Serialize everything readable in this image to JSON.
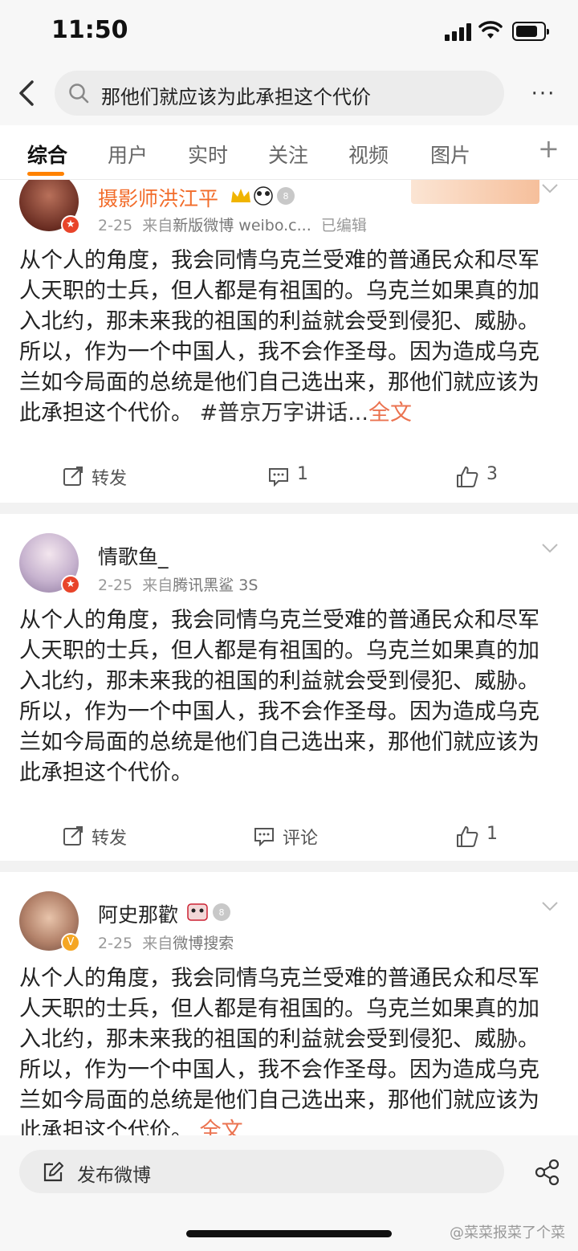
{
  "status": {
    "time": "11:50"
  },
  "search": {
    "query": "那他们就应该为此承担这个代价",
    "more": "···"
  },
  "tabs": [
    {
      "label": "综合"
    },
    {
      "label": "用户"
    },
    {
      "label": "实时"
    },
    {
      "label": "关注"
    },
    {
      "label": "视频"
    },
    {
      "label": "图片"
    }
  ],
  "tab_add": "+",
  "posts": [
    {
      "name": "摄影师洪江平",
      "date": "2-25",
      "source_prefix": "来自",
      "source": "新版微博 weibo.c...",
      "edited": "已编辑",
      "text": "从个人的角度，我会同情乌克兰受难的普通民众和尽军人天职的士兵，但人都是有祖国的。乌克兰如果真的加入北约，那未来我的祖国的利益就会受到侵犯、威胁。所以，作为一个中国人，我不会作圣母。因为造成乌克兰如今局面的总统是他们自己选出来，那他们就应该为此承担这个代价。",
      "hashtag": "#普京万字讲话...",
      "more": "全文",
      "repost": "转发",
      "comment": "1",
      "like": "3"
    },
    {
      "name": "情歌鱼_",
      "date": "2-25",
      "source_prefix": "来自",
      "source": "腾讯黑鲨 3S",
      "text": "从个人的角度，我会同情乌克兰受难的普通民众和尽军人天职的士兵，但人都是有祖国的。乌克兰如果真的加入北约，那未来我的祖国的利益就会受到侵犯、威胁。所以，作为一个中国人，我不会作圣母。因为造成乌克兰如今局面的总统是他们自己选出来，那他们就应该为此承担这个代价。",
      "repost": "转发",
      "comment": "评论",
      "like": "1"
    },
    {
      "name": "阿史那歡",
      "date": "2-25",
      "source_prefix": "来自",
      "source": "微博搜索",
      "text": "从个人的角度，我会同情乌克兰受难的普通民众和尽军人天职的士兵，但人都是有祖国的。乌克兰如果真的加入北约，那未来我的祖国的利益就会受到侵犯、威胁。所以，作为一个中国人，我不会作圣母。因为造成乌克兰如今局面的总统是他们自己选出来，那他们就应该为此承担这个代价。",
      "more": "全文"
    }
  ],
  "bottom": {
    "compose": "发布微博"
  },
  "watermark": "@菜菜报菜了个菜",
  "colors": {
    "accent": "#ff8200",
    "vip_name": "#f26c2a",
    "link": "#eb7350"
  }
}
